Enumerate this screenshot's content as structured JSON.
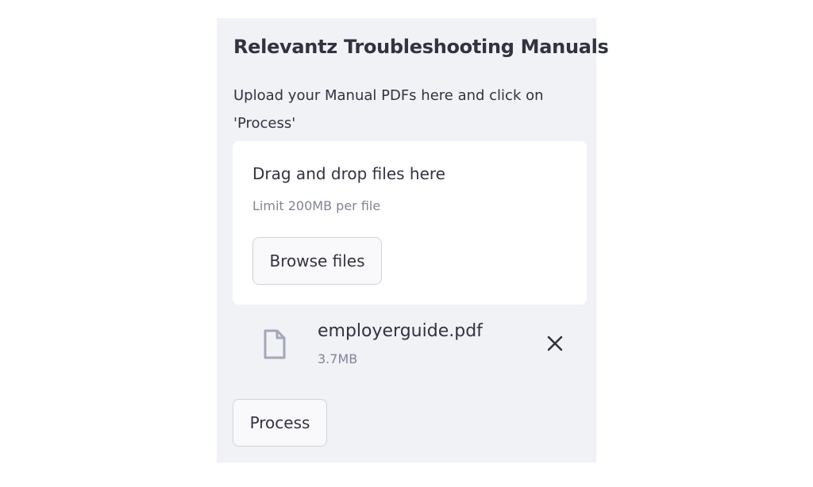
{
  "sidebar": {
    "title": "Relevantz Troubleshooting Manuals",
    "instructions": "Upload your Manual PDFs here and click on 'Process'"
  },
  "uploader": {
    "drop_label": "Drag and drop files here",
    "limit_text": "Limit 200MB per file",
    "browse_label": "Browse files"
  },
  "files": [
    {
      "name": "employerguide.pdf",
      "size": "3.7MB",
      "icon": "file-icon",
      "remove_icon": "close-icon"
    }
  ],
  "actions": {
    "process_label": "Process"
  },
  "colors": {
    "sidebar_bg": "#f0f2f6",
    "text": "#31333f",
    "muted_text": "#808495",
    "icon": "#a3a8b8"
  }
}
